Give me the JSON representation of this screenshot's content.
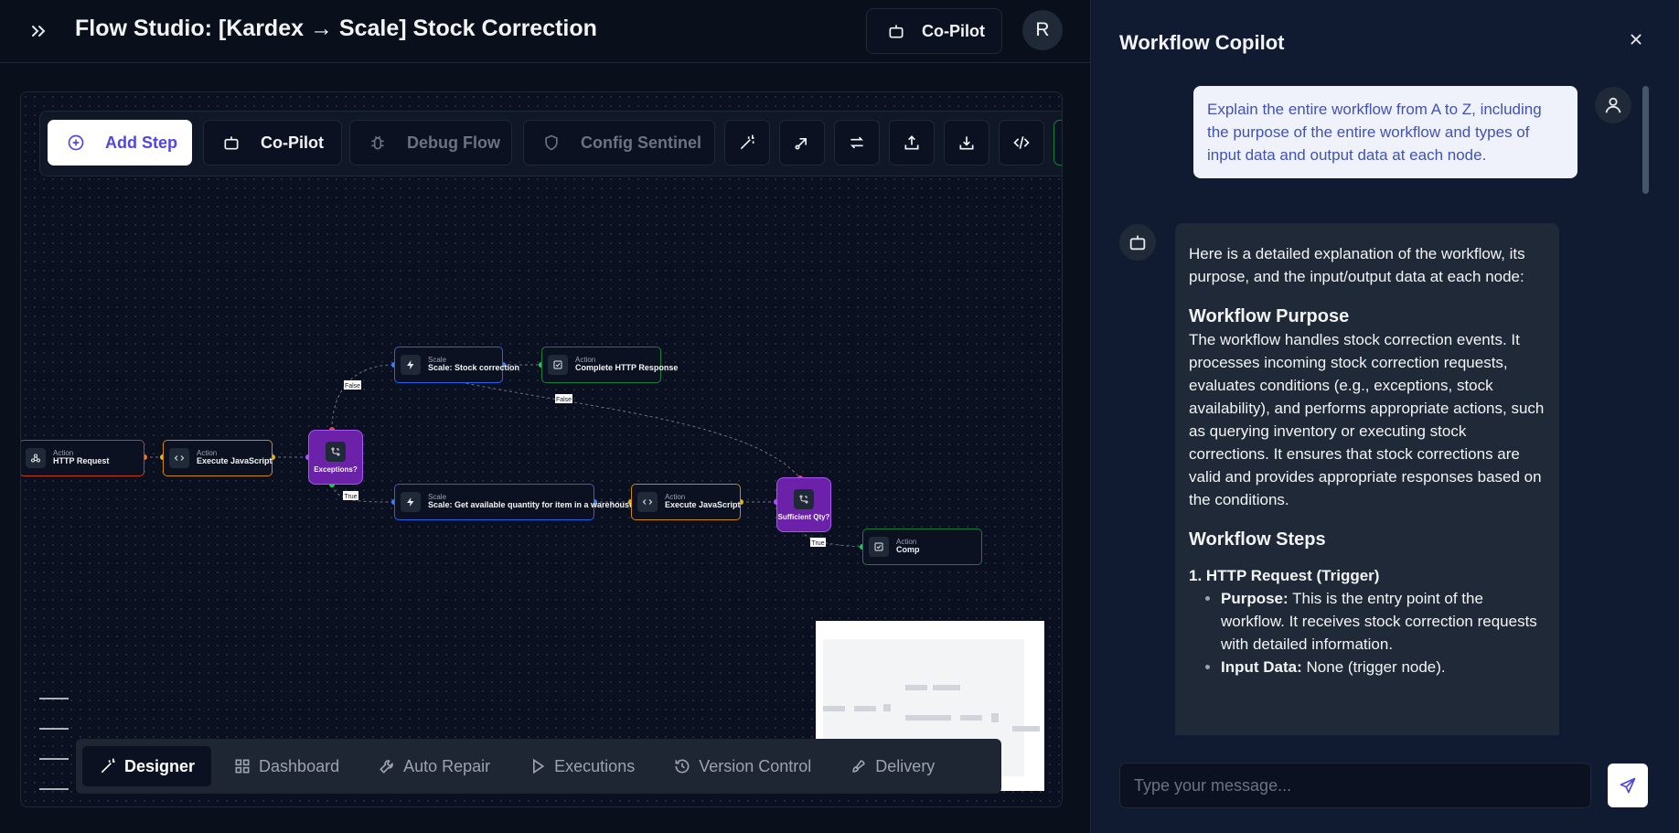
{
  "header": {
    "title": "Flow Studio: [Kardex → Scale] Stock Correction",
    "copilot_label": "Co-Pilot",
    "avatar_initial": "R"
  },
  "toolbar": {
    "add_step": "Add Step",
    "copilot": "Co-Pilot",
    "debug_flow": "Debug Flow",
    "config_sentinel": "Config Sentinel",
    "icon_buttons": [
      "wand-icon",
      "share-icon",
      "swap-icon",
      "upload-icon",
      "download-icon",
      "code-icon"
    ]
  },
  "nodes": {
    "http_request": {
      "type": "Action",
      "label": "HTTP Request"
    },
    "execute_js_1": {
      "type": "Action",
      "label": "Execute JavaScript"
    },
    "exceptions": {
      "label": "Exceptions?"
    },
    "stock_correction": {
      "type": "Scale",
      "label": "Scale: Stock correction"
    },
    "complete_http_1": {
      "type": "Action",
      "label": "Complete HTTP Response"
    },
    "get_quantity": {
      "type": "Scale",
      "label": "Scale: Get available quantity for item in a warehouse"
    },
    "execute_js_2": {
      "type": "Action",
      "label": "Execute JavaScript"
    },
    "sufficient_qty": {
      "label": "Sufficient Qty?"
    },
    "complete_http_2": {
      "type": "Action",
      "label": "Comp"
    }
  },
  "edge_labels": {
    "false_1": "False",
    "false_2": "False",
    "true_1": "True",
    "true_2": "True"
  },
  "bottom_nav": [
    {
      "label": "Designer",
      "icon": "wand-icon"
    },
    {
      "label": "Dashboard",
      "icon": "grid-icon"
    },
    {
      "label": "Auto Repair",
      "icon": "wrench-icon"
    },
    {
      "label": "Executions",
      "icon": "play-icon"
    },
    {
      "label": "Version Control",
      "icon": "history-icon"
    },
    {
      "label": "Delivery",
      "icon": "rocket-icon"
    }
  ],
  "copilot": {
    "title": "Workflow Copilot",
    "user_message": "Explain the entire workflow from A to Z, including the purpose of the entire workflow and types of input data and output data at each node.",
    "bot_intro": "Here is a detailed explanation of the workflow, its purpose, and the input/output data at each node:",
    "purpose_heading": "Workflow Purpose",
    "purpose_text": "The workflow handles stock correction events. It processes incoming stock correction requests, evaluates conditions (e.g., exceptions, stock availability), and performs appropriate actions, such as querying inventory or executing stock corrections. It ensures that stock corrections are valid and provides appropriate responses based on the conditions.",
    "steps_heading": "Workflow Steps",
    "step1_heading": "1. HTTP Request (Trigger)",
    "step1_purpose_label": "Purpose:",
    "step1_purpose_text": " This is the entry point of the workflow. It receives stock correction requests with detailed information.",
    "step1_input_label": "Input Data:",
    "step1_input_text": " None (trigger node).",
    "input_placeholder": "Type your message..."
  },
  "colors": {
    "accent": "#4f46e5",
    "condition": "#6b21a8",
    "action_orange": "#c2410c",
    "action_yellow": "#ca8a04",
    "scale_blue": "#2563eb",
    "complete_green": "#15803d"
  }
}
